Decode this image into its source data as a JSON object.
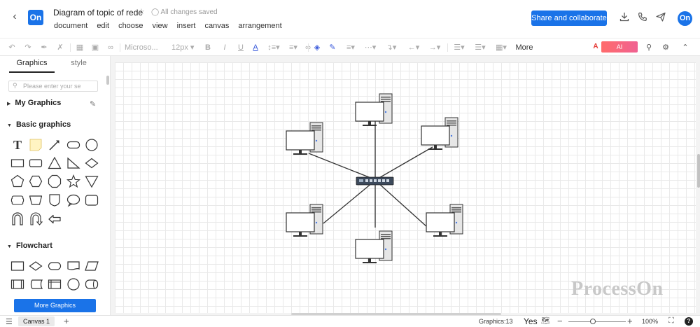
{
  "header": {
    "back_icon": "chevron-left-icon",
    "logo": "On",
    "title": "Diagram of topic of rede",
    "star_icon": "star-icon",
    "saved_status": "All changes saved",
    "menu": [
      "document",
      "edit",
      "choose",
      "view",
      "insert",
      "canvas",
      "arrangement"
    ],
    "share_label": "Share and collaborate",
    "icons": [
      "download-icon",
      "phone-icon",
      "send-icon"
    ],
    "avatar": "On",
    "accent_color": "#1a73e8"
  },
  "toolbar": {
    "font_name": "Microso...",
    "font_size": "12px",
    "more_label": "More",
    "ai_label": "AI Assistant"
  },
  "sidebar": {
    "tabs": [
      "Graphics",
      "style"
    ],
    "search_placeholder": "Please enter your se",
    "my_graphics": "My Graphics",
    "basic_graphics": "Basic graphics",
    "flowchart": "Flowchart",
    "more_graphics_label": "More Graphics"
  },
  "canvas": {
    "watermark": "ProcessOn",
    "diagram": {
      "hub": "switch",
      "nodes": [
        "computer",
        "computer",
        "computer",
        "computer",
        "computer",
        "computer"
      ]
    }
  },
  "statusbar": {
    "canvas_tab": "Canvas 1",
    "graphics_count": "Graphics:13",
    "yes_label": "Yes",
    "zoom": "100%",
    "help": "?"
  }
}
